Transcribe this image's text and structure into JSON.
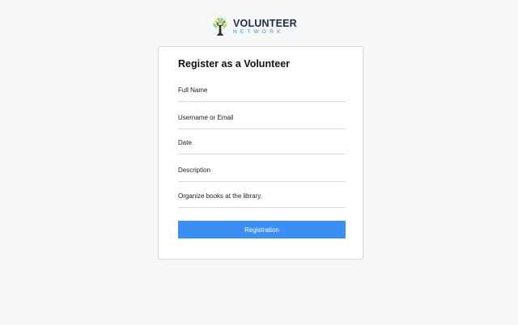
{
  "brand": {
    "name": "VOLUNTEER",
    "tagline": "NETWORK",
    "logo_icon": "tree-icon",
    "colors": {
      "title": "#1f2a44",
      "tagline": "#3a8fd6"
    }
  },
  "form": {
    "title": "Register as a Volunteer",
    "fields": [
      {
        "label": "Full Name"
      },
      {
        "label": "Username or Email"
      },
      {
        "label": "Date"
      },
      {
        "label": "Description"
      },
      {
        "label": "Organize books at the library."
      }
    ],
    "submit_label": "Registration",
    "accent_color": "#3b8ff2"
  }
}
